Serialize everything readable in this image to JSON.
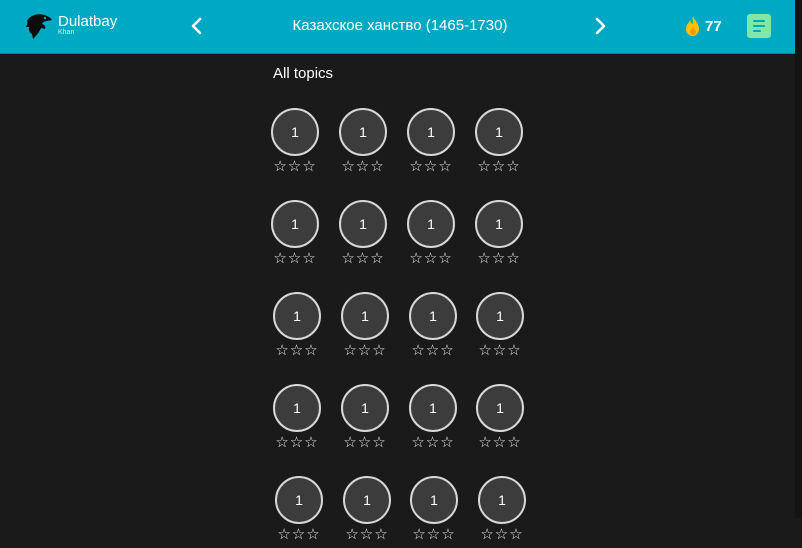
{
  "header": {
    "brand_name": "Dulatbay",
    "brand_sub": "Khan",
    "title": "Казахское ханство (1465-1730)",
    "streak_count": "77",
    "icons": {
      "logo": "eagle-logo",
      "prev": "chevron-left-icon",
      "next": "chevron-right-icon",
      "streak": "flame-icon",
      "notes": "notes-icon"
    },
    "colors": {
      "bar": "#00a9c3",
      "flame": "#ffc107",
      "notes": "#7ee8a6"
    }
  },
  "main": {
    "section_label": "All topics",
    "star_glyph": "☆",
    "levels": [
      {
        "number": "1",
        "stars_earned": 0,
        "stars_total": 3
      },
      {
        "number": "1",
        "stars_earned": 0,
        "stars_total": 3
      },
      {
        "number": "1",
        "stars_earned": 0,
        "stars_total": 3
      },
      {
        "number": "1",
        "stars_earned": 0,
        "stars_total": 3
      },
      {
        "number": "1",
        "stars_earned": 0,
        "stars_total": 3
      },
      {
        "number": "1",
        "stars_earned": 0,
        "stars_total": 3
      },
      {
        "number": "1",
        "stars_earned": 0,
        "stars_total": 3
      },
      {
        "number": "1",
        "stars_earned": 0,
        "stars_total": 3
      },
      {
        "number": "1",
        "stars_earned": 0,
        "stars_total": 3
      },
      {
        "number": "1",
        "stars_earned": 0,
        "stars_total": 3
      },
      {
        "number": "1",
        "stars_earned": 0,
        "stars_total": 3
      },
      {
        "number": "1",
        "stars_earned": 0,
        "stars_total": 3
      },
      {
        "number": "1",
        "stars_earned": 0,
        "stars_total": 3
      },
      {
        "number": "1",
        "stars_earned": 0,
        "stars_total": 3
      },
      {
        "number": "1",
        "stars_earned": 0,
        "stars_total": 3
      },
      {
        "number": "1",
        "stars_earned": 0,
        "stars_total": 3
      },
      {
        "number": "1",
        "stars_earned": 0,
        "stars_total": 3
      },
      {
        "number": "1",
        "stars_earned": 0,
        "stars_total": 3
      },
      {
        "number": "1",
        "stars_earned": 0,
        "stars_total": 3
      },
      {
        "number": "1",
        "stars_earned": 0,
        "stars_total": 3
      }
    ]
  }
}
